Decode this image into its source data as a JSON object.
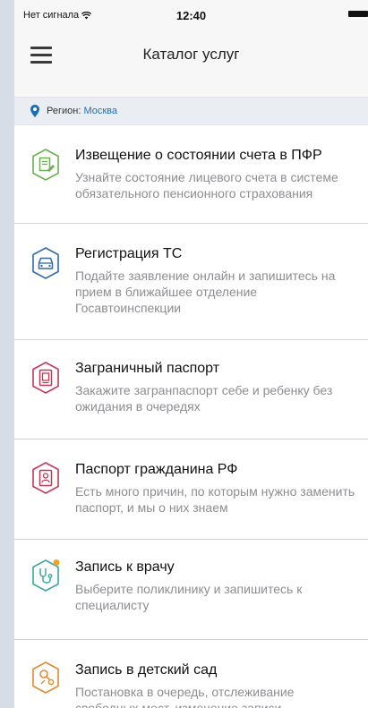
{
  "statusbar": {
    "carrier": "Нет сигнала",
    "time": "12:40"
  },
  "header": {
    "title": "Каталог услуг"
  },
  "region": {
    "label": "Регион:",
    "value": "Москва"
  },
  "services": [
    {
      "title": "Извещение о состоянии счета в ПФР",
      "desc": "Узнайте состояние лицевого счета в системе обязательного пенсионного страхования",
      "icon": "document-icon",
      "color": "#6ab04c"
    },
    {
      "title": "Регистрация ТС",
      "desc": "Подайте заявление онлайн и запишитесь на прием в ближайшее отделение Госавтоинспекции",
      "icon": "car-icon",
      "color": "#2f6aa6"
    },
    {
      "title": "Заграничный паспорт",
      "desc": "Закажите загранпаспорт себе и ребенку без ожидания в очередях",
      "icon": "passport-icon",
      "color": "#c0395b"
    },
    {
      "title": "Паспорт гражданина РФ",
      "desc": "Есть много причин, по которым нужно заменить паспорт, и мы о них знаем",
      "icon": "id-passport-icon",
      "color": "#c0395b"
    },
    {
      "title": "Запись к врачу",
      "desc": "Выберите поликлинику и запишитесь к специалисту",
      "icon": "stethoscope-icon",
      "color": "#3aa7a0"
    },
    {
      "title": "Запись в детский сад",
      "desc": "Постановка в очередь, отслеживание свободных мест, изменение записи",
      "icon": "rattle-icon",
      "color": "#e08a2c"
    }
  ]
}
